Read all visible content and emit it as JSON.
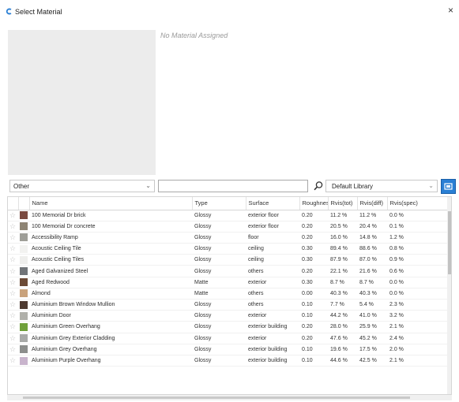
{
  "window": {
    "title": "Select Material",
    "close_label": "×"
  },
  "preview": {
    "empty_text": "No Material Assigned"
  },
  "filters": {
    "category": "Other",
    "search_value": "",
    "library": "Default Library"
  },
  "icons": {
    "app": "app-logo-icon",
    "search": "search-icon",
    "library_button": "library-browser-icon",
    "favorite": "star-outline-icon"
  },
  "columns": [
    "Name",
    "Type",
    "Surface",
    "Roughness",
    "Rvis(tot)",
    "Rvis(diff)",
    "Rvis(spec)"
  ],
  "rows": [
    {
      "swatch": "#7a4a40",
      "name": "100 Memorial Dr brick",
      "type": "Glossy",
      "surface": "exterior floor",
      "roughness": "0.20",
      "tot": "11.2 %",
      "diff": "11.2 %",
      "spec": "0.0 %"
    },
    {
      "swatch": "#8e8474",
      "name": "100 Memorial Dr concrete",
      "type": "Glossy",
      "surface": "exterior floor",
      "roughness": "0.20",
      "tot": "20.5 %",
      "diff": "20.4 %",
      "spec": "0.1 %"
    },
    {
      "swatch": "#9e9e98",
      "name": "Accessibility Ramp",
      "type": "Glossy",
      "surface": "floor",
      "roughness": "0.20",
      "tot": "16.0 %",
      "diff": "14.8 %",
      "spec": "1.2 %"
    },
    {
      "swatch": "#f2f2f0",
      "name": "Acoustic Ceiling Tile",
      "type": "Glossy",
      "surface": "ceiling",
      "roughness": "0.30",
      "tot": "89.4 %",
      "diff": "88.6 %",
      "spec": "0.8 %"
    },
    {
      "swatch": "#eeeeec",
      "name": "Acoustic Ceiling Tiles",
      "type": "Glossy",
      "surface": "ceiling",
      "roughness": "0.30",
      "tot": "87.9 %",
      "diff": "87.0 %",
      "spec": "0.9 %"
    },
    {
      "swatch": "#707478",
      "name": "Aged Galvanized Steel",
      "type": "Glossy",
      "surface": "others",
      "roughness": "0.20",
      "tot": "22.1 %",
      "diff": "21.6 %",
      "spec": "0.6 %"
    },
    {
      "swatch": "#6b4a36",
      "name": "Aged Redwood",
      "type": "Matte",
      "surface": "exterior",
      "roughness": "0.30",
      "tot": "8.7 %",
      "diff": "8.7 %",
      "spec": "0.0 %"
    },
    {
      "swatch": "#c9a27c",
      "name": "Almond",
      "type": "Matte",
      "surface": "others",
      "roughness": "0.00",
      "tot": "40.3 %",
      "diff": "40.3 %",
      "spec": "0.0 %"
    },
    {
      "swatch": "#4e3a30",
      "name": "Aluminium Brown Window Mullion",
      "type": "Glossy",
      "surface": "others",
      "roughness": "0.10",
      "tot": "7.7 %",
      "diff": "5.4 %",
      "spec": "2.3 %"
    },
    {
      "swatch": "#b0b0aa",
      "name": "Aluminium Door",
      "type": "Glossy",
      "surface": "exterior",
      "roughness": "0.10",
      "tot": "44.2 %",
      "diff": "41.0 %",
      "spec": "3.2 %"
    },
    {
      "swatch": "#6fa03a",
      "name": "Aluminium Green Overhang",
      "type": "Glossy",
      "surface": "exterior building",
      "roughness": "0.20",
      "tot": "28.0 %",
      "diff": "25.9 %",
      "spec": "2.1 %"
    },
    {
      "swatch": "#a8aaa8",
      "name": "Aluminium Grey Exterior Cladding",
      "type": "Glossy",
      "surface": "exterior",
      "roughness": "0.20",
      "tot": "47.6 %",
      "diff": "45.2 %",
      "spec": "2.4 %"
    },
    {
      "swatch": "#8c8e8c",
      "name": "Aluminium Grey Overhang",
      "type": "Glossy",
      "surface": "exterior building",
      "roughness": "0.10",
      "tot": "19.6 %",
      "diff": "17.5 %",
      "spec": "2.0 %"
    },
    {
      "swatch": "#c8b4cc",
      "name": "Aluminium Purple Overhang",
      "type": "Glossy",
      "surface": "exterior building",
      "roughness": "0.10",
      "tot": "44.6 %",
      "diff": "42.5 %",
      "spec": "2.1 %"
    }
  ]
}
